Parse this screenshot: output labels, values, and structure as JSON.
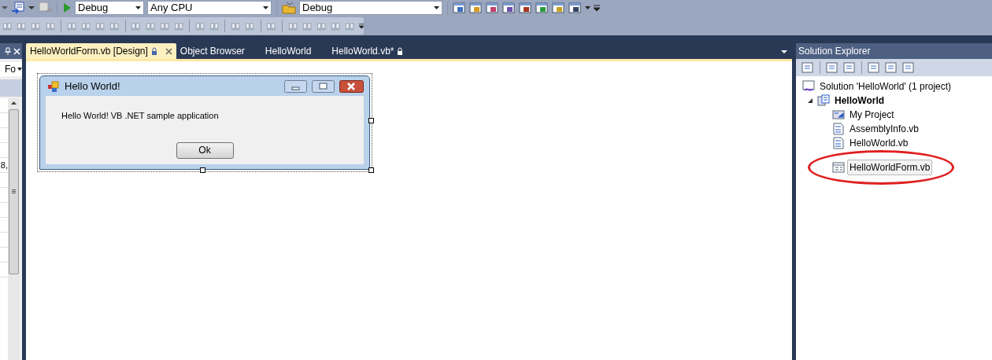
{
  "toolbar": {
    "combos": [
      {
        "value": "Debug"
      },
      {
        "value": "Any CPU"
      },
      {
        "value": "Debug"
      }
    ]
  },
  "left_panel": {
    "combo_value": "Fo",
    "cell_text": "8,"
  },
  "tabs": [
    {
      "label": "HelloWorldForm.vb [Design]",
      "selected": true,
      "locked": true
    },
    {
      "label": "Object Browser",
      "selected": false,
      "locked": false
    },
    {
      "label": "HelloWorld",
      "selected": false,
      "locked": false
    },
    {
      "label": "HelloWorld.vb*",
      "selected": false,
      "locked": true
    }
  ],
  "designer": {
    "form_title": "Hello World!",
    "label": "Hello World! VB .NET sample application",
    "button": "Ok"
  },
  "solution_explorer": {
    "title": "Solution Explorer",
    "tree": [
      {
        "label": "Solution 'HelloWorld' (1 project)",
        "kind": "solution",
        "selected": false,
        "children": [
          {
            "label": "HelloWorld",
            "kind": "project",
            "selected": false,
            "expanded": true,
            "children": [
              {
                "label": "My Project",
                "kind": "myproject",
                "selected": false
              },
              {
                "label": "AssemblyInfo.vb",
                "kind": "vbfile",
                "selected": false
              },
              {
                "label": "HelloWorld.vb",
                "kind": "vbfile",
                "selected": false
              },
              {
                "label": "HelloWorldForm.vb",
                "kind": "form",
                "selected": true
              }
            ]
          }
        ]
      }
    ]
  }
}
